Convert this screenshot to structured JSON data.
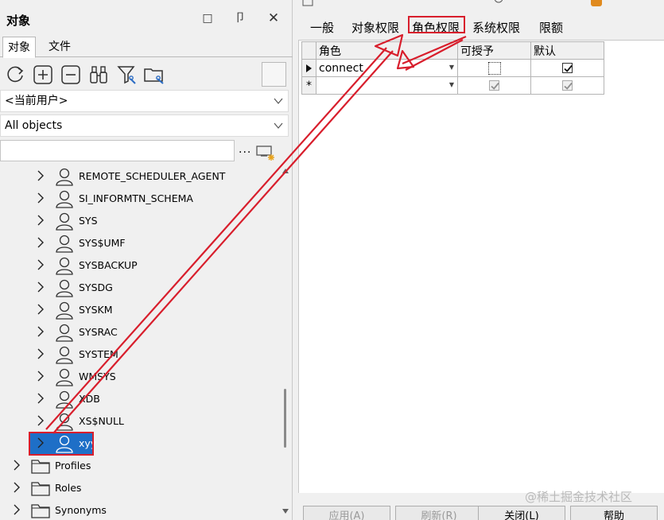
{
  "panel": {
    "title": "对象",
    "restore_glyph": "□",
    "pin_glyph": "卩",
    "close_glyph": "✕"
  },
  "left_tabs": [
    {
      "label": "对象"
    },
    {
      "label": "文件"
    }
  ],
  "toolbar": {
    "icons": [
      "refresh-icon",
      "add-icon",
      "remove-icon",
      "binoculars-icon",
      "filter-icon",
      "folder-settings-icon"
    ]
  },
  "combos": {
    "user": "<当前用户>",
    "object_types": "All objects"
  },
  "filter": {
    "value": "",
    "dots": "..."
  },
  "tree": {
    "users": [
      "REMOTE_SCHEDULER_AGENT",
      "SI_INFORMTN_SCHEMA",
      "SYS",
      "SYS$UMF",
      "SYSBACKUP",
      "SYSDG",
      "SYSKM",
      "SYSRAC",
      "SYSTEM",
      "WMSYS",
      "XDB",
      "XS$NULL",
      "xyy"
    ],
    "selected_user": "xyy",
    "folders": [
      "Profiles",
      "Roles",
      "Synonyms"
    ]
  },
  "right_tabs": [
    {
      "label": "一般"
    },
    {
      "label": "对象权限"
    },
    {
      "label": "角色权限"
    },
    {
      "label": "系统权限"
    },
    {
      "label": "限额"
    }
  ],
  "grid": {
    "headers": [
      "角色",
      "可授予",
      "默认"
    ],
    "rows": [
      {
        "marker": "▶",
        "role": "connect",
        "grantable": false,
        "default": true
      },
      {
        "marker": "*",
        "role": "",
        "grantable": true,
        "default": true
      }
    ]
  },
  "buttons": {
    "apply": "应用(A)",
    "refresh": "刷新(R)",
    "close": "关闭(L)",
    "help": "帮助"
  },
  "watermark": "@稀土掘金技术社区",
  "colors": {
    "selection": "#1e6fc7",
    "annotation_red": "#d81e2c"
  }
}
